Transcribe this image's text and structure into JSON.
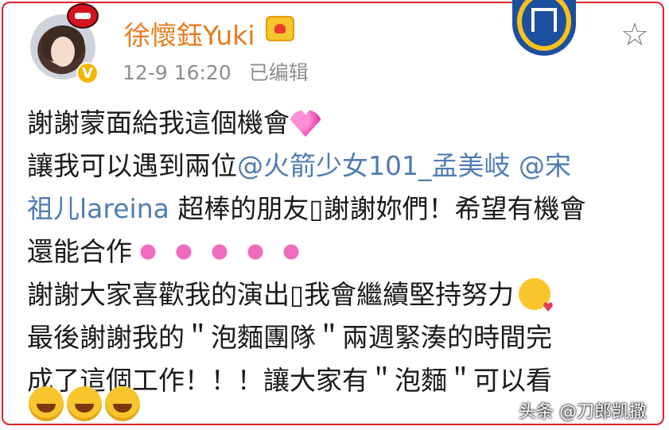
{
  "post": {
    "author": "徐懷鈺Yuki",
    "timestamp": "12-9 16:20",
    "edited_label": "已编辑",
    "verified_badge": "V",
    "accent_color": "#e87a1a",
    "mention_color": "#4f7cb3",
    "lines": {
      "l1": "謝謝蒙面給我這個機會",
      "l2_pre": "讓我可以遇到兩位",
      "l2_mention": "@火箭少女101_孟美岐 @宋",
      "l3_mention": "祖儿lareina",
      "l3_post": " 超棒的朋友",
      "l3_post2": "謝謝妳們！希望有機會",
      "l4": "還能合作",
      "l5a": "謝謝大家喜歡我的演出",
      "l5b": "我會繼續堅持努力",
      "l6": "最後謝謝我的＂泡麵團隊＂兩週緊湊的時間完",
      "l7": "成了這個工作！！！讓大家有＂泡麵＂可以看"
    }
  },
  "icons": {
    "star": "☆",
    "missing_glyph": "▯"
  },
  "watermark": "头条 @刀郎凯撒"
}
